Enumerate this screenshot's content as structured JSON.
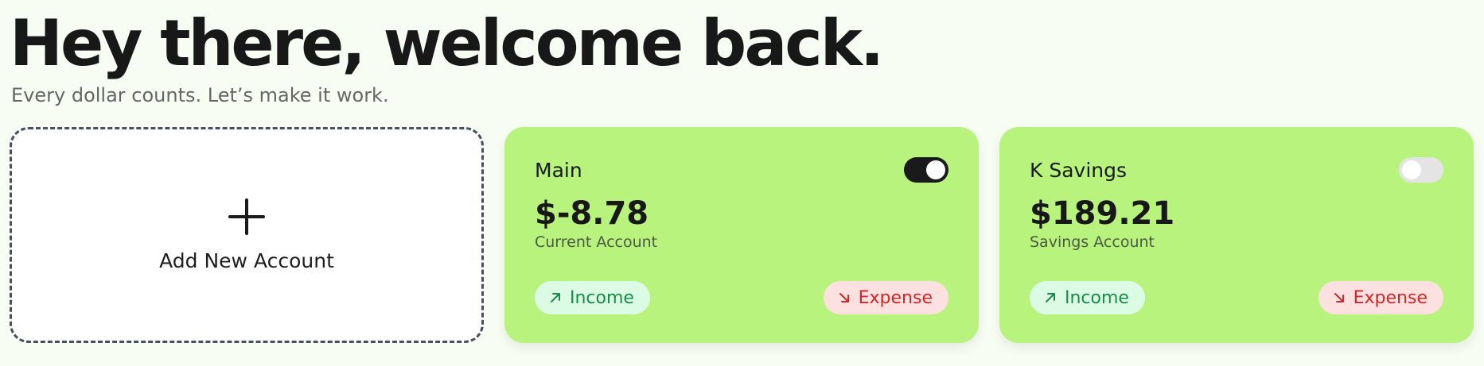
{
  "header": {
    "title": "Hey there, welcome back.",
    "subtitle": "Every dollar counts. Let’s make it work."
  },
  "add_account": {
    "label": "Add New Account",
    "icon": "plus-icon"
  },
  "accounts": [
    {
      "name": "Main",
      "balance": "$-8.78",
      "type": "Current Account",
      "toggle_on": true,
      "income_label": "Income",
      "expense_label": "Expense"
    },
    {
      "name": "K Savings",
      "balance": "$189.21",
      "type": "Savings Account",
      "toggle_on": false,
      "income_label": "Income",
      "expense_label": "Expense"
    }
  ],
  "colors": {
    "card_bg": "#b8f47d",
    "income_text": "#1a8c4a",
    "income_bg": "#dcfbe5",
    "expense_text": "#d02828",
    "expense_bg": "#fde0e0",
    "page_bg": "#f7fdf3"
  }
}
